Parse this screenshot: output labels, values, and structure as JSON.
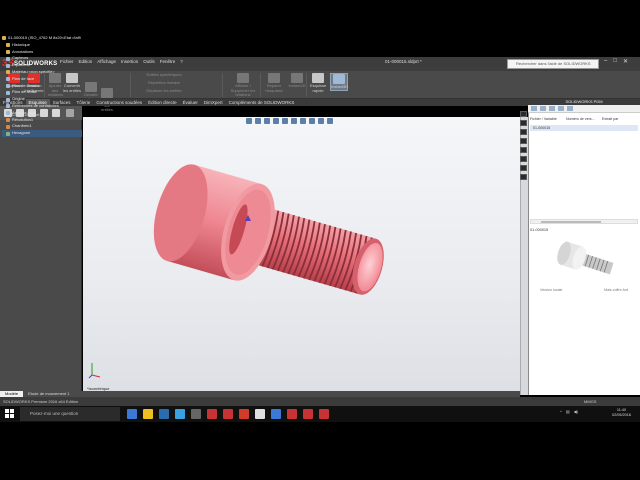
{
  "app": {
    "logo_brand": "3S",
    "logo_text": "SOLIDWORKS",
    "file_title": "01-000015.sldprt *",
    "search_placeholder": "Rechercher dans l'aide de SOLIDWORKS"
  },
  "menus": [
    "Fichier",
    "Edition",
    "Affichage",
    "Insertion",
    "Outils",
    "Fenêtre",
    "?"
  ],
  "ribbon": {
    "items": [
      {
        "label": "Esquisse",
        "sub": "",
        "dim": false
      },
      {
        "label": "Cotation",
        "sub": "intelligente",
        "dim": false
      },
      {
        "label": "Ajouter des",
        "sub": "relations",
        "dim": true
      },
      {
        "label": "Convertir",
        "sub": "les entités",
        "dim": false
      },
      {
        "label": "Décaler",
        "sub": "les entités",
        "dim": true
      },
      {
        "label": "Ajuster",
        "sub": "les entités",
        "dim": true
      },
      {
        "label": "Entités symétriques",
        "sub": "",
        "dim": true
      },
      {
        "label": "Répétition linéaire",
        "sub": "",
        "dim": true
      },
      {
        "label": "Déplacer les entités",
        "sub": "",
        "dim": true
      },
      {
        "label": "Afficher / Supprimer",
        "sub": "les relations",
        "dim": true
      },
      {
        "label": "Réparer",
        "sub": "l'esquisse",
        "dim": true
      },
      {
        "label": "Instant2D",
        "sub": "",
        "dim": true
      },
      {
        "label": "Esquisse",
        "sub": "rapide",
        "dim": false
      },
      {
        "label": "Instant3D",
        "sub": "",
        "dim": false
      }
    ]
  },
  "tabs": [
    "Fonctions",
    "Esquisse",
    "Surfaces",
    "Tôlerie",
    "Constructions soudées",
    "Édition directe",
    "Évaluer",
    "DimXpert",
    "Compléments de SOLIDWORKS"
  ],
  "active_tab": "Esquisse",
  "feature_manager": {
    "doc_tab": "01-000015.sldprt",
    "root": "01-000015 (ISO_4762 M 8x20<Etat d'affi",
    "items": [
      {
        "label": "Historique",
        "icon": "folder-icon",
        "color": "y"
      },
      {
        "label": "Annotations",
        "icon": "annotations-icon",
        "color": "y"
      },
      {
        "label": "Capteurs",
        "icon": "sensor-icon",
        "color": "b"
      },
      {
        "label": "Equations",
        "icon": "equation-icon",
        "color": "b"
      },
      {
        "label": "Matériau <non spécifié>",
        "icon": "material-icon",
        "color": "y"
      },
      {
        "label": "Plan de face",
        "icon": "plane-icon",
        "color": "b"
      },
      {
        "label": "Plan de dessus",
        "icon": "plane-icon",
        "color": "b"
      },
      {
        "label": "Plan de droite",
        "icon": "plane-icon",
        "color": "b"
      },
      {
        "label": "Origine",
        "icon": "origin-icon",
        "color": "b"
      },
      {
        "label": "Références de contraintes",
        "icon": "mate-icon",
        "color": "b"
      },
      {
        "label": "Axes de base",
        "icon": "axis-icon",
        "color": "b"
      },
      {
        "label": "Révolution1",
        "icon": "revolve-icon",
        "color": "o"
      },
      {
        "label": "Chanfrein1",
        "icon": "chamfer-icon",
        "color": "o"
      },
      {
        "label": "Hexagone",
        "icon": "sketch-icon",
        "color": "g"
      }
    ]
  },
  "viewport": {
    "view_label": "*Isométrique"
  },
  "model_tabs": [
    "Modèle",
    "Etude de mouvement 1"
  ],
  "task_pane": {
    "title": "SOLIDWORKS PDM",
    "columns": [
      "Fichier / Variable",
      "Numéro de vers...",
      "Extrait par"
    ],
    "row": "01-000015",
    "part_name": "01-000015",
    "bottom_left": "Version locale",
    "bottom_right": "Mais coffre-fort"
  },
  "status": {
    "left": "SOLIDWORKS Premium 2016 x64 Edition",
    "right": "MMGS"
  },
  "taskbar": {
    "search_text": "Posez-moi une question",
    "time": "11:40",
    "date": "02/05/2016",
    "app_colors": [
      "#3b78d8",
      "#f0c020",
      "#2b6cb0",
      "#3aa0e0",
      "#666666",
      "#c83232",
      "#c83232",
      "#d23a2a",
      "#e0e0e0",
      "#3b78d8",
      "#c83232",
      "#c83232",
      "#c83232"
    ]
  },
  "colors": {
    "bolt": "#f07880",
    "bolt_dark": "#b8404b",
    "thread": "#8a2f38"
  }
}
